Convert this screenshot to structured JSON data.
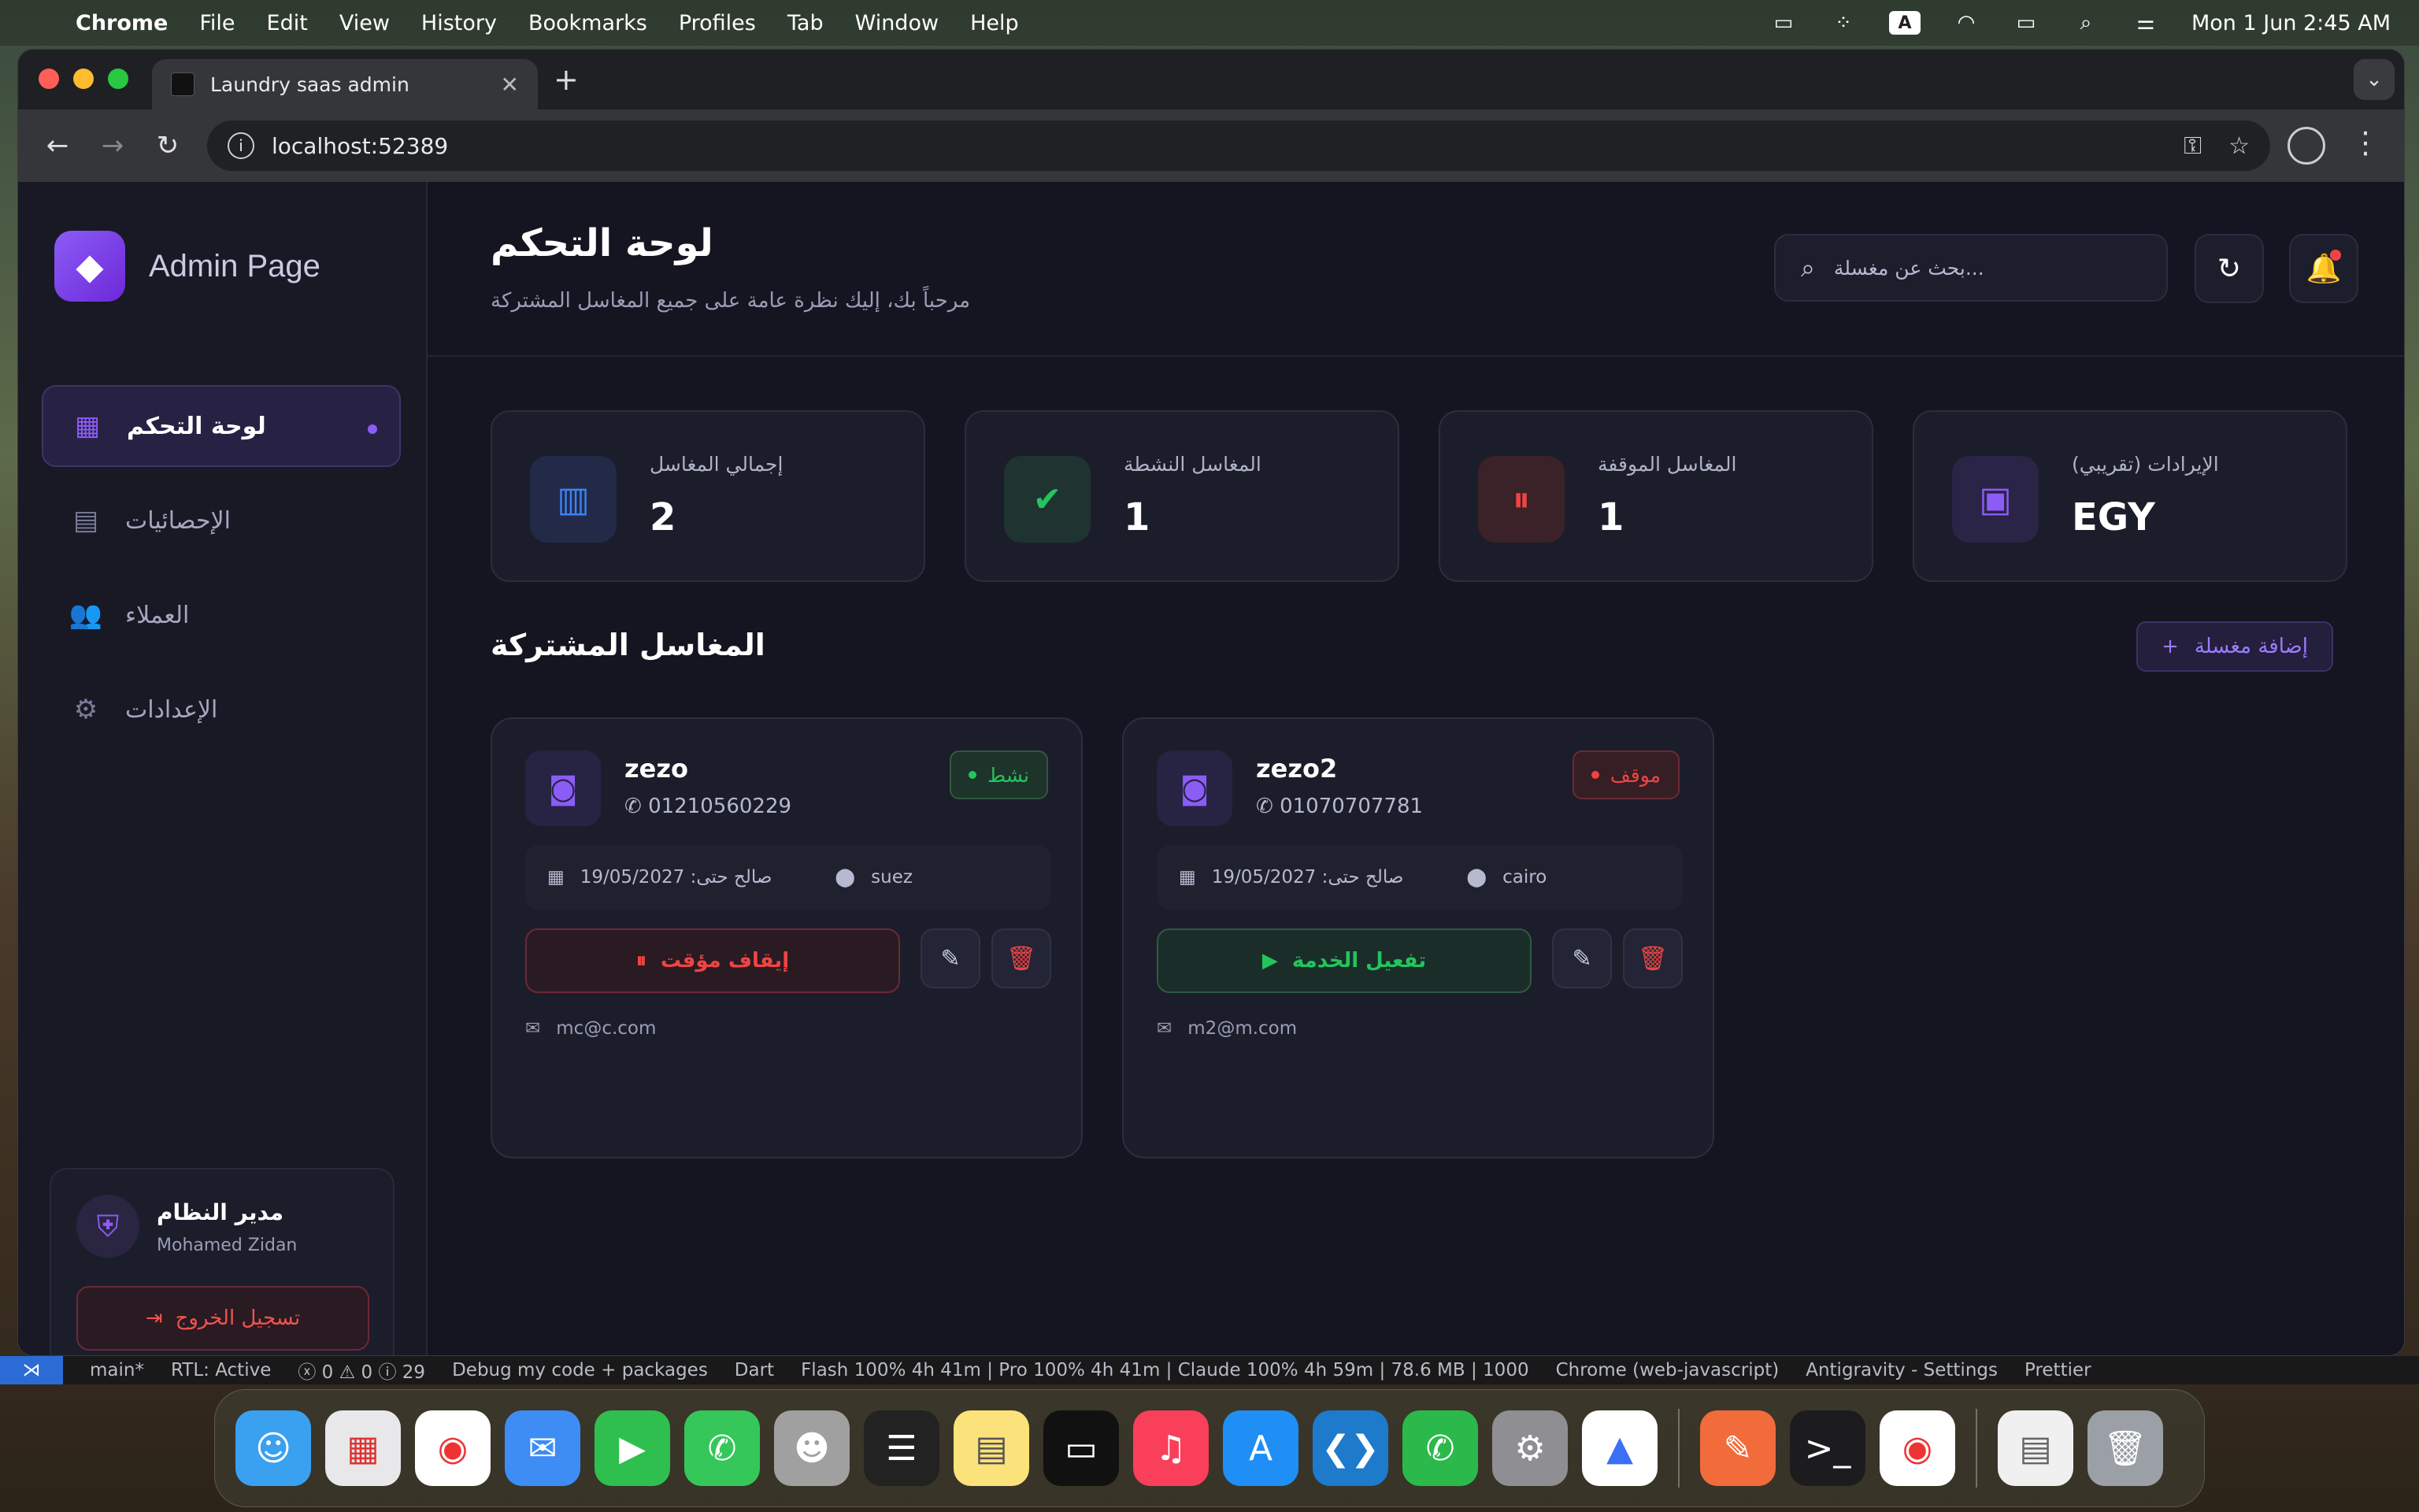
{
  "menubar": {
    "app": "Chrome",
    "items": [
      "File",
      "Edit",
      "View",
      "History",
      "Bookmarks",
      "Profiles",
      "Tab",
      "Window",
      "Help"
    ],
    "input_source": "A",
    "clock": "Mon 1 Jun  2:45 AM"
  },
  "browser": {
    "tab_title": "Laundry saas admin",
    "url": "localhost:52389"
  },
  "sidebar": {
    "brand": "Admin Page",
    "items": [
      {
        "label": "لوحة التحكم",
        "icon": "dashboard-icon",
        "active": true
      },
      {
        "label": "الإحصائيات",
        "icon": "stats-icon",
        "active": false
      },
      {
        "label": "العملاء",
        "icon": "users-icon",
        "active": false
      },
      {
        "label": "الإعدادات",
        "icon": "gear-icon",
        "active": false
      }
    ],
    "user": {
      "role": "مدير النظام",
      "name": "Mohamed Zidan"
    },
    "logout_label": "تسجيل الخروج"
  },
  "header": {
    "title": "لوحة التحكم",
    "subtitle": "مرحباً بك، إليك نظرة عامة على جميع المغاسل المشتركة",
    "search_placeholder": "بحث عن مغسلة..."
  },
  "stats": [
    {
      "label": "إجمالي المغاسل",
      "value": "2",
      "icon": "store-icon",
      "color": "#3b82f6"
    },
    {
      "label": "المغاسل النشطة",
      "value": "1",
      "icon": "check-circle-icon",
      "color": "#22c55e"
    },
    {
      "label": "المغاسل الموقفة",
      "value": "1",
      "icon": "pause-circle-icon",
      "color": "#ef4444"
    },
    {
      "label": "الإيرادات (تقريبي)",
      "value": "EGY",
      "icon": "wallet-icon",
      "color": "#8b5cf6"
    }
  ],
  "laundries": {
    "section_title": "المغاسل المشتركة",
    "add_label": "إضافة مغسلة",
    "items": [
      {
        "name": "zezo",
        "phone": "01210560229",
        "status": "نشط",
        "status_color": "#22c55e",
        "valid_until": "19/05/2027 :صالح حتى",
        "location": "suez",
        "action_label": "إيقاف مؤقت",
        "action_type": "pause",
        "email": "mc@c.com"
      },
      {
        "name": "zezo2",
        "phone": "01070707781",
        "status": "موقف",
        "status_color": "#ef4444",
        "valid_until": "19/05/2027 :صالح حتى",
        "location": "cairo",
        "action_label": "تفعيل الخدمة",
        "action_type": "activate",
        "email": "m2@m.com"
      }
    ]
  },
  "vscode_status": {
    "branch": "main*",
    "rtl": "RTL: Active",
    "problems": "0 ⚠ 0 ⓘ 29",
    "debug": "Debug my code + packages",
    "lang": "Dart",
    "models": "Flash 100% 4h 41m | Pro 100% 4h 41m | Claude 100% 4h 59m | 78.6 MB | 1000",
    "target": "Chrome (web-javascript)",
    "ext": "Antigravity - Settings",
    "prettier": "Prettier"
  }
}
